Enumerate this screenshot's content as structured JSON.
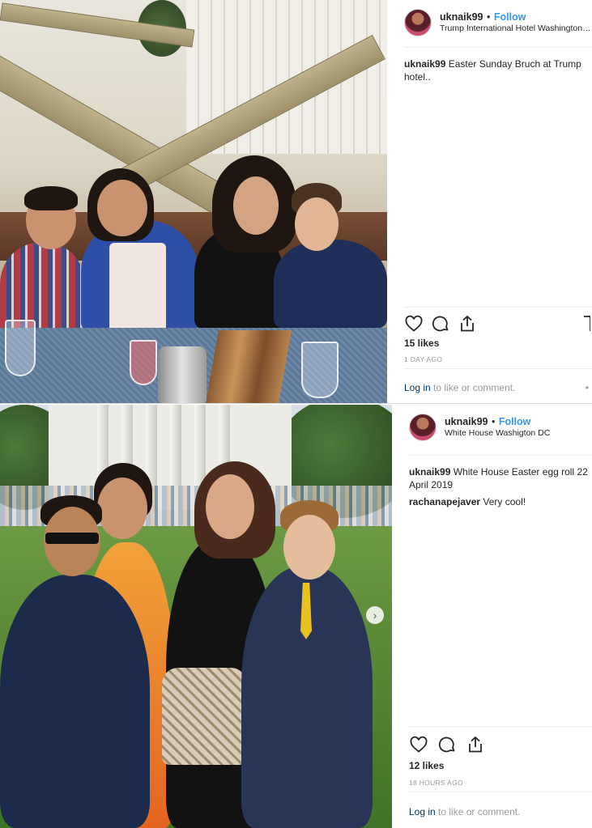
{
  "posts": [
    {
      "username": "uknaik99",
      "follow_label": "Follow",
      "dot": "•",
      "location": "Trump International Hotel Washington, D.C.",
      "caption_user": "uknaik99",
      "caption_text": "Easter Sunday Bruch at Trump hotel..",
      "likes": "15 likes",
      "time_ago": "1 DAY AGO",
      "login_link": "Log in",
      "login_text": "to like or comment.",
      "more": "•"
    },
    {
      "username": "uknaik99",
      "follow_label": "Follow",
      "dot": "•",
      "location": "White House Washigton DC",
      "caption_user": "uknaik99",
      "caption_text": "White House Easter egg roll 22 April 2019",
      "comment_user": "rachanapejaver",
      "comment_text": "Very cool!",
      "likes": "12 likes",
      "time_ago": "18 HOURS AGO",
      "login_link": "Log in",
      "login_text": "to like or comment.",
      "next_icon": "›"
    }
  ],
  "colors": {
    "follow": "#3897f0",
    "link": "#003569",
    "muted": "#999999",
    "text": "#262626"
  },
  "icons": [
    "heart-icon",
    "comment-icon",
    "share-icon",
    "bookmark-icon",
    "next-arrow-icon"
  ]
}
